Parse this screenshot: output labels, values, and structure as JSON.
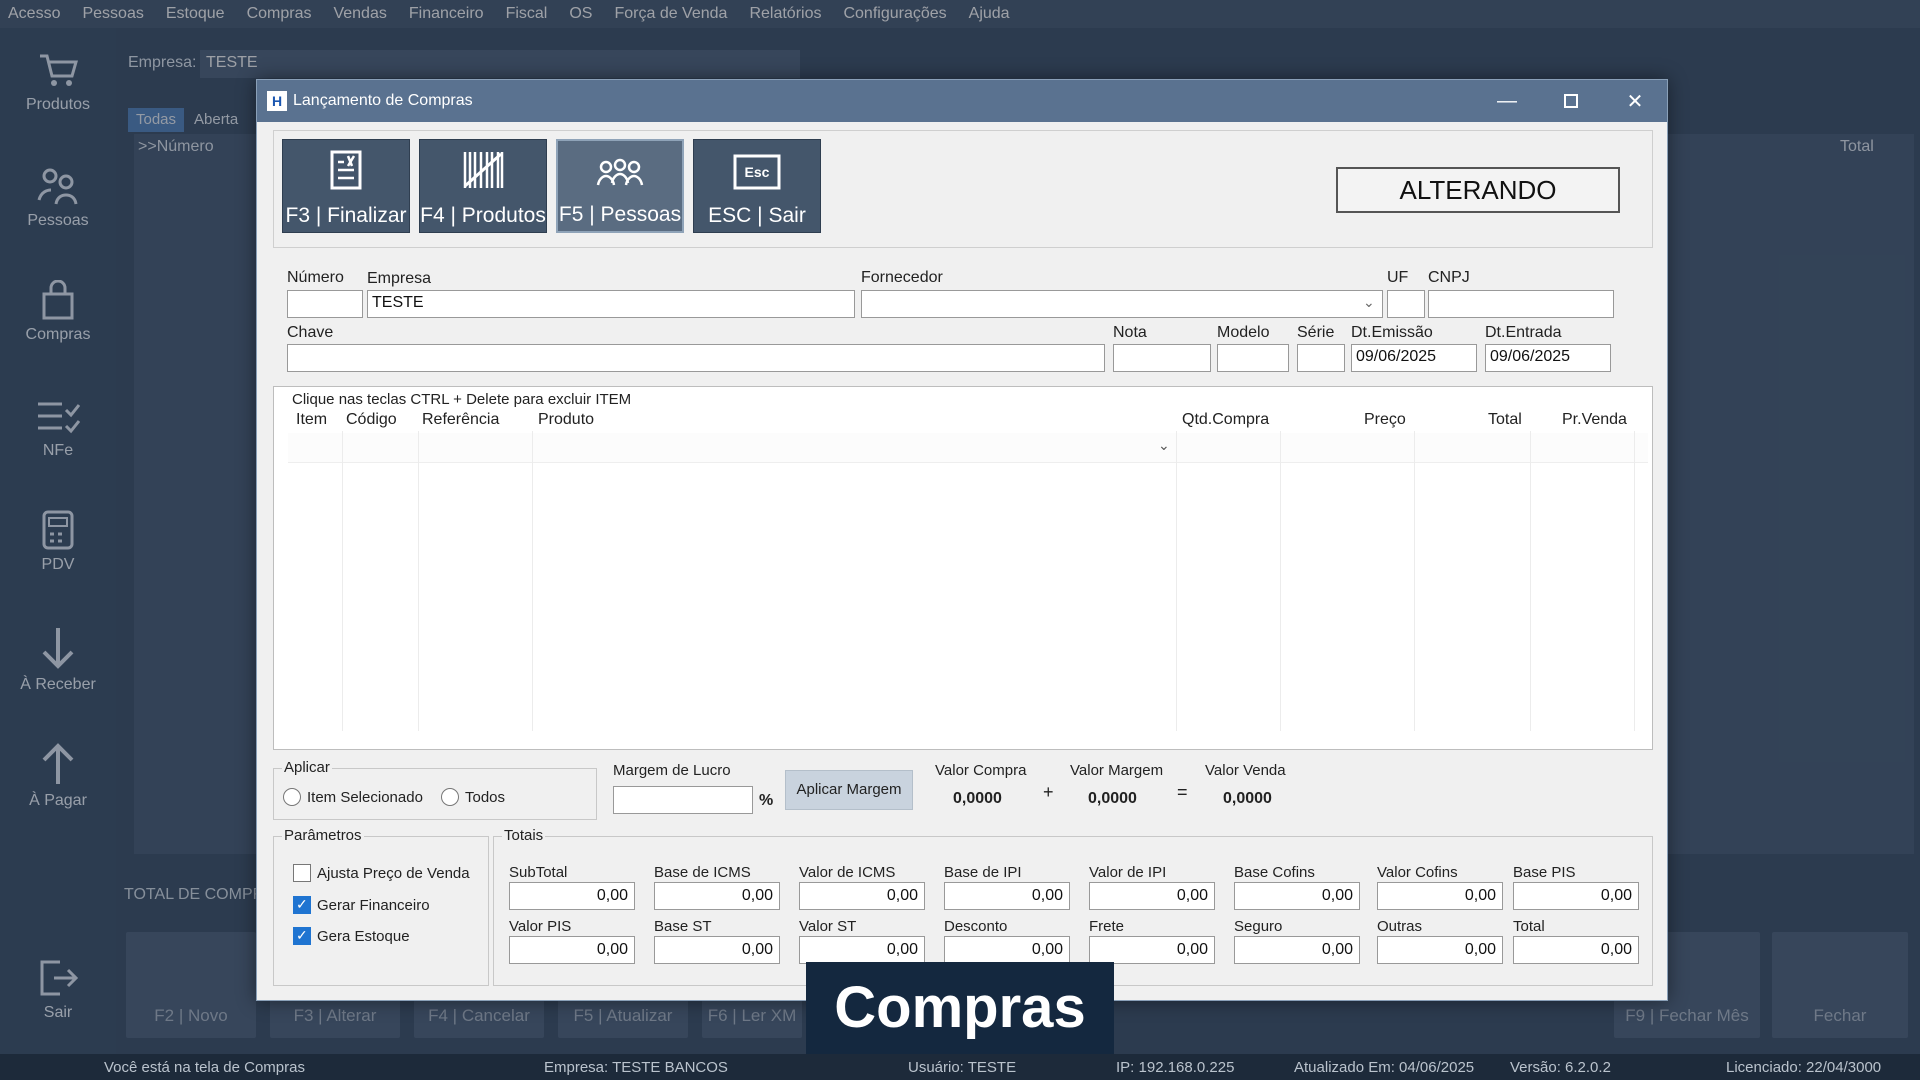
{
  "menu": [
    "Acesso",
    "Pessoas",
    "Estoque",
    "Compras",
    "Vendas",
    "Financeiro",
    "Fiscal",
    "OS",
    "Força de Venda",
    "Relatórios",
    "Configurações",
    "Ajuda"
  ],
  "sidebar": [
    {
      "label": "Produtos",
      "icon": "cart-icon"
    },
    {
      "label": "Pessoas",
      "icon": "people-icon"
    },
    {
      "label": "Compras",
      "icon": "bag-icon"
    },
    {
      "label": "NFe",
      "icon": "list-check-icon"
    },
    {
      "label": "PDV",
      "icon": "pos-icon"
    },
    {
      "label": "À Receber",
      "icon": "arrow-down-icon"
    },
    {
      "label": "À Pagar",
      "icon": "arrow-up-icon"
    },
    {
      "label": "Sair",
      "icon": "exit-icon"
    }
  ],
  "background": {
    "empresa_label": "Empresa:",
    "empresa_value": "TESTE",
    "tabs": [
      "Todas",
      "Aberta"
    ],
    "col_numero": ">>Número",
    "col_total": "Total",
    "total_label": "TOTAL DE COMPR",
    "buttons": [
      "F2 | Novo",
      "F3 | Alterar",
      "F4 | Cancelar",
      "F5 | Atualizar",
      "F6 | Ler XM",
      "F9 | Fechar Mês",
      "Fechar"
    ]
  },
  "statusbar": {
    "tela": "Você está na tela de Compras",
    "empresa": "Empresa: TESTE BANCOS",
    "usuario": "Usuário: TESTE",
    "ip": "IP: 192.168.0.225",
    "atualizado": "Atualizado Em: 04/06/2025",
    "versao": "Versão: 6.2.0.2",
    "licenciado": "Licenciado: 22/04/3000"
  },
  "dialog": {
    "title": "Lançamento de Compras",
    "toolbar": [
      {
        "label": "F3 | Finalizar",
        "icon": "finalize-icon"
      },
      {
        "label": "F4 | Produtos",
        "icon": "barcode-icon"
      },
      {
        "label": "F5 | Pessoas",
        "icon": "people-icon"
      },
      {
        "label": "ESC | Sair",
        "icon": "esc-key-icon"
      }
    ],
    "status": "ALTERANDO",
    "fields": {
      "numero_label": "Número",
      "numero": "",
      "empresa_label": "Empresa",
      "empresa": "TESTE",
      "fornecedor_label": "Fornecedor",
      "fornecedor": "",
      "uf_label": "UF",
      "uf": "",
      "cnpj_label": "CNPJ",
      "cnpj": "",
      "chave_label": "Chave",
      "chave": "",
      "nota_label": "Nota",
      "nota": "",
      "modelo_label": "Modelo",
      "modelo": "",
      "serie_label": "Série",
      "serie": "",
      "dt_emissao_label": "Dt.Emissão",
      "dt_emissao": "09/06/2025",
      "dt_entrada_label": "Dt.Entrada",
      "dt_entrada": "09/06/2025"
    },
    "grid": {
      "hint": "Clique nas teclas CTRL + Delete para excluir ITEM",
      "columns": [
        "Item",
        "Código",
        "Referência",
        "Produto",
        "Qtd.Compra",
        "Preço",
        "Total",
        "Pr.Venda"
      ]
    },
    "aplicar": {
      "title": "Aplicar",
      "opt1": "Item Selecionado",
      "opt2": "Todos"
    },
    "margem": {
      "label": "Margem de Lucro",
      "value": "",
      "unit": "%",
      "button": "Aplicar Margem",
      "valor_compra_label": "Valor Compra",
      "valor_compra": "0,0000",
      "plus": "+",
      "valor_margem_label": "Valor Margem",
      "valor_margem": "0,0000",
      "equals": "=",
      "valor_venda_label": "Valor Venda",
      "valor_venda": "0,0000"
    },
    "parametros": {
      "title": "Parâmetros",
      "items": [
        {
          "label": "Ajusta Preço de Venda",
          "checked": false
        },
        {
          "label": "Gerar Financeiro",
          "checked": true
        },
        {
          "label": "Gera Estoque",
          "checked": true
        }
      ]
    },
    "totais": {
      "title": "Totais",
      "row1": [
        {
          "label": "SubTotal",
          "value": "0,00"
        },
        {
          "label": "Base de ICMS",
          "value": "0,00"
        },
        {
          "label": "Valor de ICMS",
          "value": "0,00"
        },
        {
          "label": "Base de IPI",
          "value": "0,00"
        },
        {
          "label": "Valor de IPI",
          "value": "0,00"
        },
        {
          "label": "Base Cofins",
          "value": "0,00"
        },
        {
          "label": "Valor Cofins",
          "value": "0,00"
        },
        {
          "label": "Base PIS",
          "value": "0,00"
        }
      ],
      "row2": [
        {
          "label": "Valor PIS",
          "value": "0,00"
        },
        {
          "label": "Base ST",
          "value": "0,00"
        },
        {
          "label": "Valor ST",
          "value": "0,00"
        },
        {
          "label": "Desconto",
          "value": "0,00"
        },
        {
          "label": "Frete",
          "value": "0,00"
        },
        {
          "label": "Seguro",
          "value": "0,00"
        },
        {
          "label": "Outras",
          "value": "0,00"
        },
        {
          "label": "Total",
          "value": "0,00"
        }
      ]
    }
  },
  "caption": "Compras"
}
